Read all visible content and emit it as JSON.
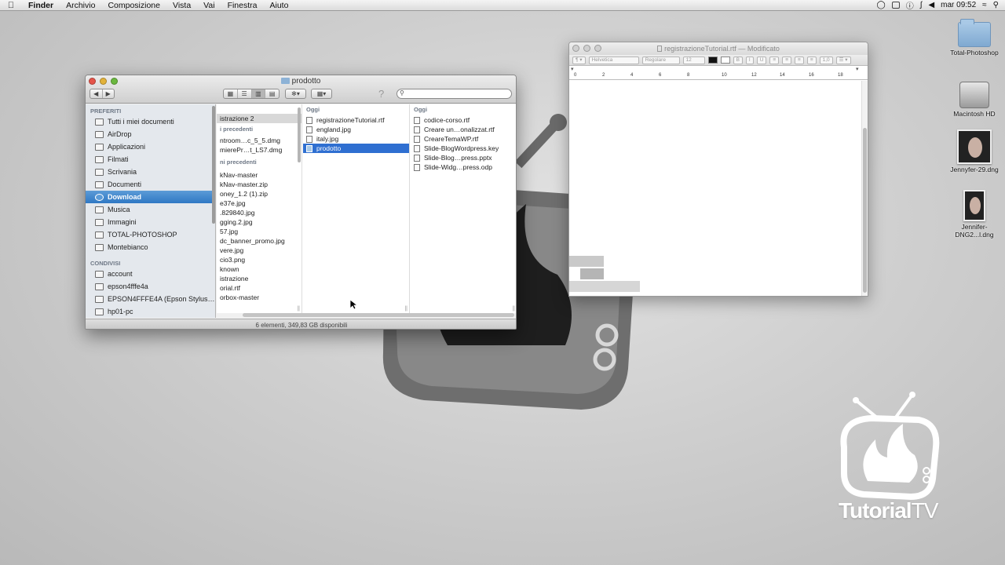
{
  "menubar": {
    "apple": "",
    "items": [
      "Finder",
      "Archivio",
      "Composizione",
      "Vista",
      "Vai",
      "Finestra",
      "Aiuto"
    ],
    "clock": "mar 09:52"
  },
  "desktop": {
    "icons": [
      {
        "label": "Total-Photoshop",
        "kind": "folder"
      },
      {
        "label": "Macintosh HD",
        "kind": "drive"
      },
      {
        "label": "Jennyfer-29.dng",
        "kind": "photo"
      },
      {
        "label": "Jennifer-DNG2...l.dng",
        "kind": "photo"
      }
    ],
    "brand": {
      "bold": "Tutorial",
      "light": "TV"
    }
  },
  "finder": {
    "title": "prodotto",
    "search_placeholder": "",
    "help": "?",
    "sidebar": {
      "favorites_header": "PREFERITI",
      "favorites": [
        "Tutti i miei documenti",
        "AirDrop",
        "Applicazioni",
        "Filmati",
        "Scrivania",
        "Documenti",
        "Download",
        "Musica",
        "Immagini",
        "TOTAL-PHOTOSHOP",
        "Montebianco"
      ],
      "selected": "Download",
      "shared_header": "CONDIVISI",
      "shared": [
        "account",
        "epson4fffe4a",
        "EPSON4FFFE4A (Epson Stylus…",
        "hp01-pc"
      ]
    },
    "col1": {
      "rows": [
        {
          "t": "istrazione 2",
          "style": "gray"
        },
        {
          "t": "i precedenti",
          "style": "hdr"
        },
        {
          "t": "ntroom…c_5_5.dmg"
        },
        {
          "t": "mierePr…t_LS7.dmg"
        },
        {
          "t": "ni precedenti",
          "style": "hdr"
        },
        {
          "t": "kNav-master"
        },
        {
          "t": "kNav-master.zip"
        },
        {
          "t": "oney_1.2 (1).zip"
        },
        {
          "t": "e37e.jpg"
        },
        {
          "t": ".829840.jpg"
        },
        {
          "t": "gging.2.jpg"
        },
        {
          "t": "57.jpg"
        },
        {
          "t": "dc_banner_promo.jpg"
        },
        {
          "t": "vere.jpg"
        },
        {
          "t": "cio3.png"
        },
        {
          "t": "known"
        },
        {
          "t": "istrazione"
        },
        {
          "t": "orial.rtf"
        },
        {
          "t": "orbox-master"
        }
      ]
    },
    "col2": {
      "header": "Oggi",
      "rows": [
        "registrazioneTutorial.rtf",
        "england.jpg",
        "italy.jpg",
        "prodotto"
      ],
      "selected": "prodotto"
    },
    "col3": {
      "header": "Oggi",
      "rows": [
        "codice-corso.rtf",
        "Creare un…onalizzat.rtf",
        "CreareTemaWP.rtf",
        "Slide-BlogWordpress.key",
        "Slide-Blog…press.pptx",
        "Slide-Widg…press.odp"
      ]
    },
    "status": "6 elementi, 349,83 GB disponibili"
  },
  "textedit": {
    "title": "registrazioneTutorial.rtf",
    "modified": "— Modificato",
    "font": "Helvetica",
    "style": "Regolare",
    "size": "12",
    "spacing": "1,0",
    "ruler_numbers": [
      "0",
      "2",
      "4",
      "6",
      "8",
      "10",
      "12",
      "14",
      "16",
      "18"
    ]
  }
}
